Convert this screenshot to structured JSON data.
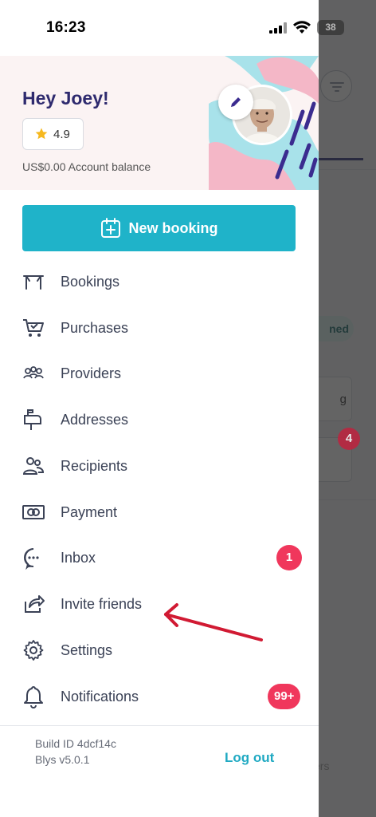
{
  "status_bar": {
    "time": "16:23",
    "battery": "38"
  },
  "profile": {
    "greeting": "Hey Joey!",
    "rating": "4.9",
    "balance": "US$0.00 Account balance"
  },
  "actions": {
    "new_booking": "New booking"
  },
  "menu": [
    {
      "label": "Bookings",
      "icon": "bookings-icon"
    },
    {
      "label": "Purchases",
      "icon": "cart-icon"
    },
    {
      "label": "Providers",
      "icon": "providers-icon"
    },
    {
      "label": "Addresses",
      "icon": "mailbox-icon"
    },
    {
      "label": "Recipients",
      "icon": "recipients-icon"
    },
    {
      "label": "Payment",
      "icon": "payment-icon"
    },
    {
      "label": "Inbox",
      "icon": "chat-icon",
      "badge": "1"
    },
    {
      "label": "Invite friends",
      "icon": "share-icon"
    },
    {
      "label": "Settings",
      "icon": "gear-icon"
    },
    {
      "label": "Notifications",
      "icon": "bell-icon",
      "badge": "99+"
    }
  ],
  "footer": {
    "build_id": "Build ID 4dcf14c",
    "version": "Blys v5.0.1",
    "logout": "Log out"
  },
  "background": {
    "pill_partial": "ned",
    "card_partial": "g",
    "badge": "4",
    "footer_partial": "ers"
  },
  "colors": {
    "accent": "#1fb3c9",
    "brand_text": "#2e2a6e",
    "badge": "#f0375c",
    "annotation_arrow": "#d11a33"
  }
}
